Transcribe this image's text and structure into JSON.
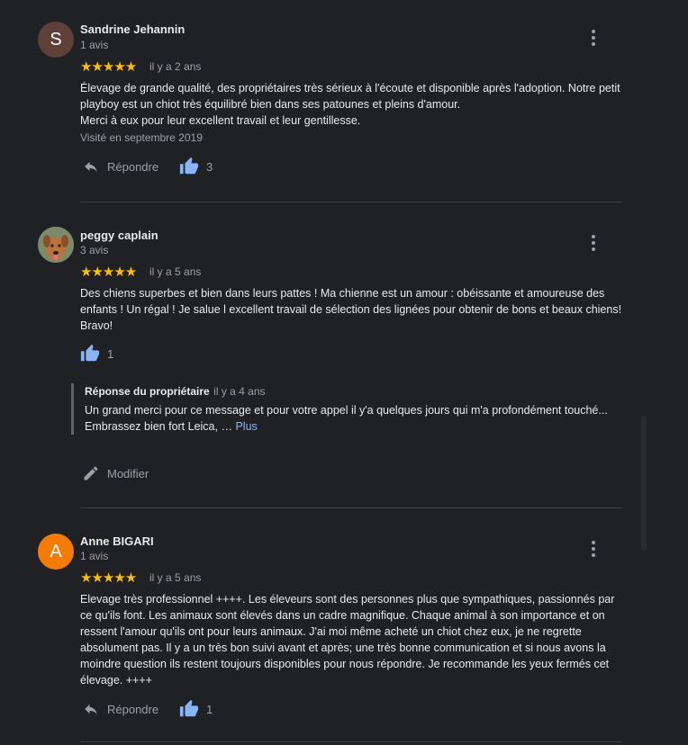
{
  "reviews": [
    {
      "avatar_letter": "S",
      "avatar_color": "#5d4037",
      "name": "Sandrine Jehannin",
      "count": "1 avis",
      "stars": "★★★★★",
      "date": "il y a 2 ans",
      "text_lines": [
        "Élevage de grande qualité, des propriétaires très sérieux à l'écoute et disponible après l'adoption. Notre petit playboy est un chiot très équilibré bien dans ses patounes et pleins d'amour.",
        "Merci à eux pour leur excellent travail et leur gentillesse."
      ],
      "visited": "Visité en septembre 2019",
      "reply_label": "Répondre",
      "likes": "3"
    },
    {
      "avatar_color": "#6b7a5c",
      "name": "peggy caplain",
      "count": "3 avis",
      "stars": "★★★★★",
      "date": "il y a 5 ans",
      "text": "Des chiens superbes et bien dans leurs pattes ! Ma chienne est un amour : obéissante et amoureuse des enfants ! Un régal ! Je salue l excellent travail de sélection des lignées pour obtenir de bons et beaux chiens! Bravo!",
      "likes": "1",
      "owner_reply": {
        "title": "Réponse du propriétaire",
        "date": "il y a 4 ans",
        "line1": "Un grand merci pour ce message et pour votre appel il y'a quelques jours qui m'a profondément touché...",
        "line2": "Embrassez bien fort Leica, …",
        "more": "Plus"
      },
      "edit_label": "Modifier"
    },
    {
      "avatar_letter": "A",
      "avatar_color": "#f57c00",
      "name": "Anne BIGARI",
      "count": "1 avis",
      "stars": "★★★★★",
      "date": "il y a 5 ans",
      "text": "Elevage très professionnel ++++. Les éleveurs sont des personnes plus que sympathiques, passionnés par ce qu'ils font. Les animaux sont élevés dans un cadre magnifique. Chaque animal à son importance et on ressent l'amour qu'ils ont pour leurs animaux. J'ai moi même acheté un chiot chez eux, je ne regrette absolument pas. Il y a un très bon suivi avant et après; une très bonne communication et si nous avons la moindre question ils restent toujours disponibles pour nous répondre. Je recommande les yeux fermés cet élevage. ++++",
      "reply_label": "Répondre",
      "likes": "1"
    }
  ],
  "colors": {
    "background": "#202124",
    "star": "#fbbc04",
    "like_blue": "#8ab4f8",
    "link": "#8ab4f8"
  },
  "icons": [
    "more-vert-icon",
    "reply-icon",
    "thumb-up-icon",
    "edit-pencil-icon"
  ]
}
